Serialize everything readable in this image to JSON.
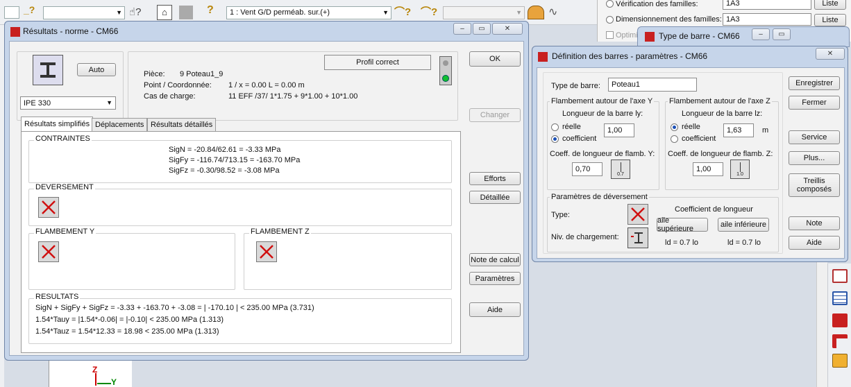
{
  "toolbar": {
    "loadcase_value": "1 : Vent G/D perméab. sur.(+)"
  },
  "bg_right": {
    "verif_label": "Vérification des familles:",
    "verif_value": "1A3",
    "verif_btn": "Liste",
    "dim_label": "Dimensionnement des familles:",
    "dim_value": "1A3",
    "dim_btn": "Liste",
    "optim_label": "Optimis"
  },
  "type_barre_win": {
    "title": "Type de barre - CM66"
  },
  "results": {
    "title": "Résultats - norme - CM66",
    "auto_btn": "Auto",
    "profile_select": "IPE 330",
    "piece_label": "Pièce:",
    "piece_value": "9  Poteau1_9",
    "point_label": "Point / Coordonnée:",
    "point_value": "1 / x = 0.00 L = 0.00 m",
    "cas_label": "Cas de charge:",
    "cas_value": "11 EFF /37/  1*1.75 + 9*1.00 + 10*1.00",
    "profil_status": "Profil correct",
    "ok_btn": "OK",
    "changer_btn": "Changer",
    "efforts_btn": "Efforts",
    "detaillee_btn": "Détaillée",
    "note_calcul_btn": "Note de calcul",
    "parametres_btn": "Paramètres",
    "aide_btn": "Aide",
    "tabs": [
      "Résultats simplifiés",
      "Déplacements",
      "Résultats détaillés"
    ],
    "contraintes_title": "CONTRAINTES",
    "contraintes_lines": [
      "SigN = -20.84/62.61 = -3.33 MPa",
      "SigFy = -116.74/713.15 = -163.70 MPa",
      "SigFz = -0.30/98.52 = -3.08 MPa"
    ],
    "deversement_title": "DEVERSEMENT",
    "flamb_y_title": "FLAMBEMENT Y",
    "flamb_z_title": "FLAMBEMENT Z",
    "resultats_title": "RESULTATS",
    "resultats_lines": [
      "SigN + SigFy + SigFz = -3.33 + -163.70 + -3.08 = | -170.10 | < 235.00 MPa  (3.731)",
      "1.54*Tauy = |1.54*-0.06| = |-0.10| < 235.00 MPa   (1.313)",
      "1.54*Tauz = 1.54*12.33 = 18.98 < 235.00 MPa   (1.313)"
    ]
  },
  "definition": {
    "title": "Définition des barres - paramètres - CM66",
    "type_label": "Type de barre:",
    "type_value": "Poteau1",
    "flamb_y_title": "Flambement autour de l'axe Y",
    "flamb_z_title": "Flambement autour de l'axe Z",
    "long_y_label": "Longueur de la barre ly:",
    "long_z_label": "Longueur de la barre lz:",
    "reelle": "réelle",
    "coefficient": "coefficient",
    "ly_value": "1,00",
    "lz_value": "1,63",
    "unit_m": "m",
    "coef_y_label": "Coeff. de longueur de flamb. Y:",
    "coef_z_label": "Coeff. de longueur de flamb. Z:",
    "coef_y_value": "0,70",
    "coef_z_value": "1,00",
    "icon_y_text": "0.7",
    "icon_z_text": "1.0",
    "dev_title": "Paramètres de déversement",
    "type2_label": "Type:",
    "niv_label": "Niv. de chargement:",
    "coef_long_label": "Coefficient de longueur",
    "aile_sup_btn": "aile supérieure",
    "aile_inf_btn": "aile inférieure",
    "ld_sup": "ld = 0.7 lo",
    "ld_inf": "ld = 0.7 lo",
    "enregistrer_btn": "Enregistrer",
    "fermer_btn": "Fermer",
    "service_btn": "Service",
    "plus_btn": "Plus...",
    "treillis_line1": "Treillis",
    "treillis_line2": "composés",
    "note_btn": "Note",
    "aide_btn": "Aide"
  },
  "axes": {
    "z": "Z",
    "y": "Y"
  }
}
